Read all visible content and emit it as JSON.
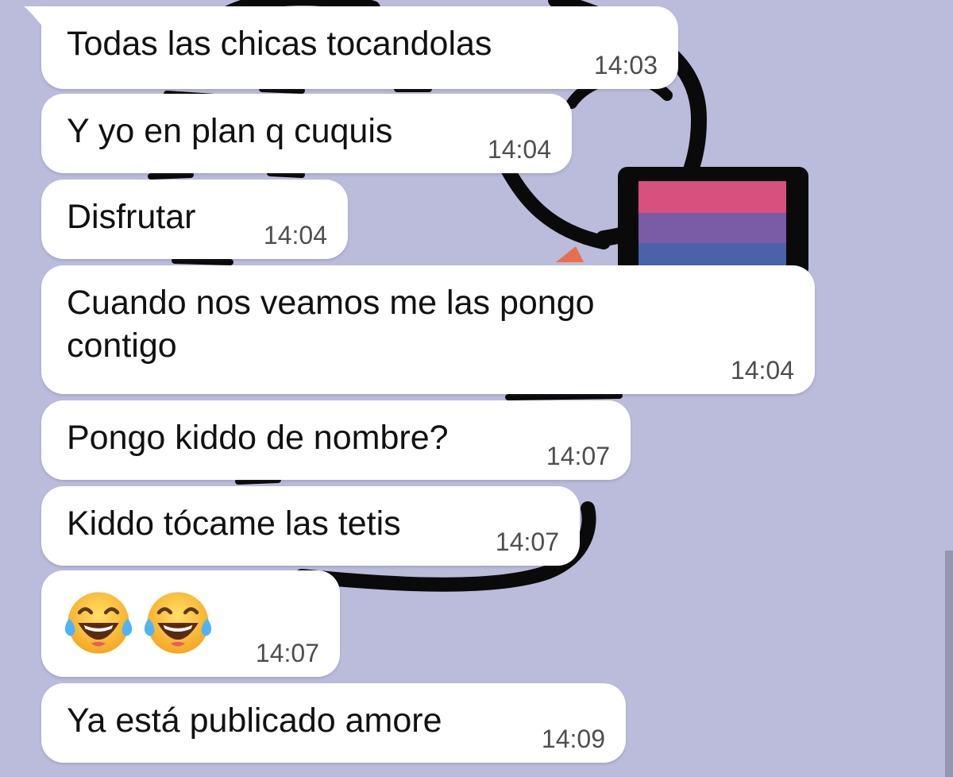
{
  "chat": {
    "messages": [
      {
        "text": "Todas las chicas tocandolas",
        "time": "14:03"
      },
      {
        "text": "Y yo en plan q cuquis",
        "time": "14:04"
      },
      {
        "text": "Disfrutar",
        "time": "14:04"
      },
      {
        "text": "Cuando nos veamos me las pongo contigo",
        "time": "14:04"
      },
      {
        "text": "Pongo kiddo de nombre?",
        "time": "14:07"
      },
      {
        "text": "Kiddo tócame las tetis",
        "time": "14:07"
      },
      {
        "emoji": [
          "face-with-tears-of-joy",
          "face-with-tears-of-joy"
        ],
        "time": "14:07"
      },
      {
        "text": "Ya está publicado amore",
        "time": "14:09"
      }
    ]
  },
  "colors": {
    "background": "#bbbbdb",
    "bubble": "#ffffff",
    "text": "#111111",
    "time": "#4e4e4e",
    "flag_pink": "#d8507e",
    "flag_purple": "#7a5ba5",
    "flag_blue": "#4a62a8"
  }
}
